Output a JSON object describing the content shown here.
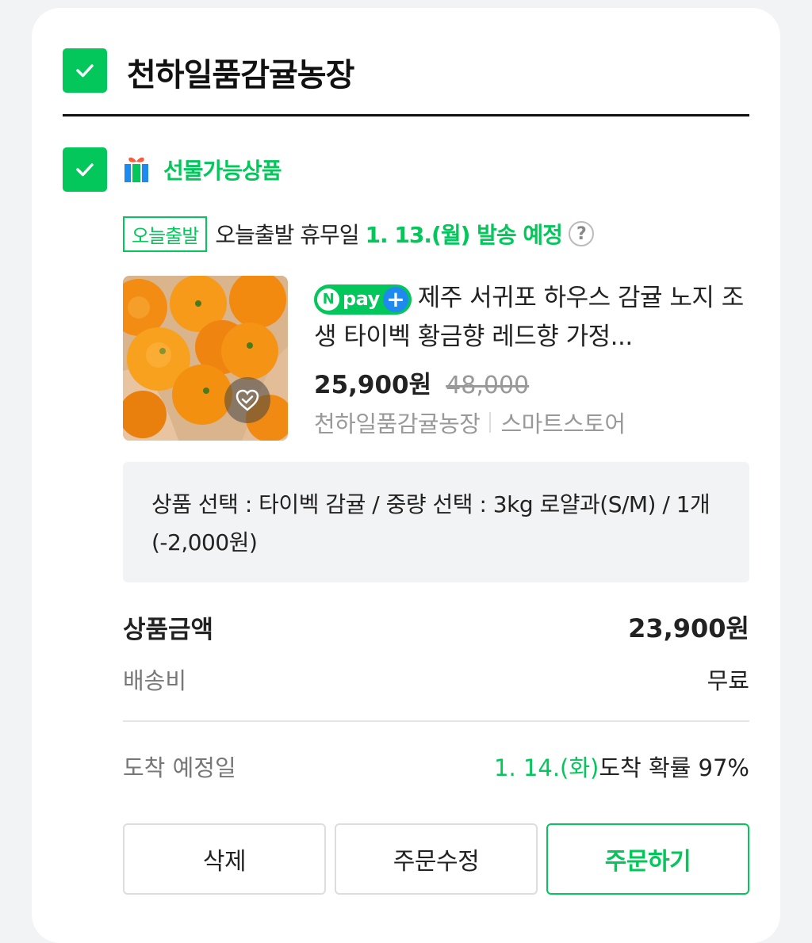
{
  "store": {
    "name": "천하일품감귤농장"
  },
  "gift": {
    "label": "선물가능상품"
  },
  "shipping": {
    "badge": "오늘출발",
    "text": "오늘출발 휴무일",
    "date": "1. 13.(월) 발송 예정",
    "help": "?"
  },
  "product": {
    "npay_n": "N",
    "npay_text": "pay",
    "npay_plus": "+",
    "title": "제주 서귀포 하우스 감귤 노지 조생 타이벡 황금향 레드향 가정...",
    "price": "25,900원",
    "original_price": "48,000",
    "seller": "천하일품감귤농장",
    "channel": "스마트스토어"
  },
  "option": {
    "text": "상품 선택 : 타이벡 감귤 / 중량 선택 : 3kg 로얄과(S/M) / 1개 (-2,000원)"
  },
  "summary": {
    "amount_label": "상품금액",
    "amount_value": "23,900원",
    "shipping_label": "배송비",
    "shipping_value": "무료",
    "arrival_label": "도착 예정일",
    "arrival_date": "1. 14.(화)",
    "arrival_prob": "도착 확률 97%"
  },
  "buttons": {
    "delete": "삭제",
    "edit": "주문수정",
    "order": "주문하기"
  },
  "colors": {
    "accent": "#03c75a",
    "npay_plus": "#1e8af0"
  }
}
